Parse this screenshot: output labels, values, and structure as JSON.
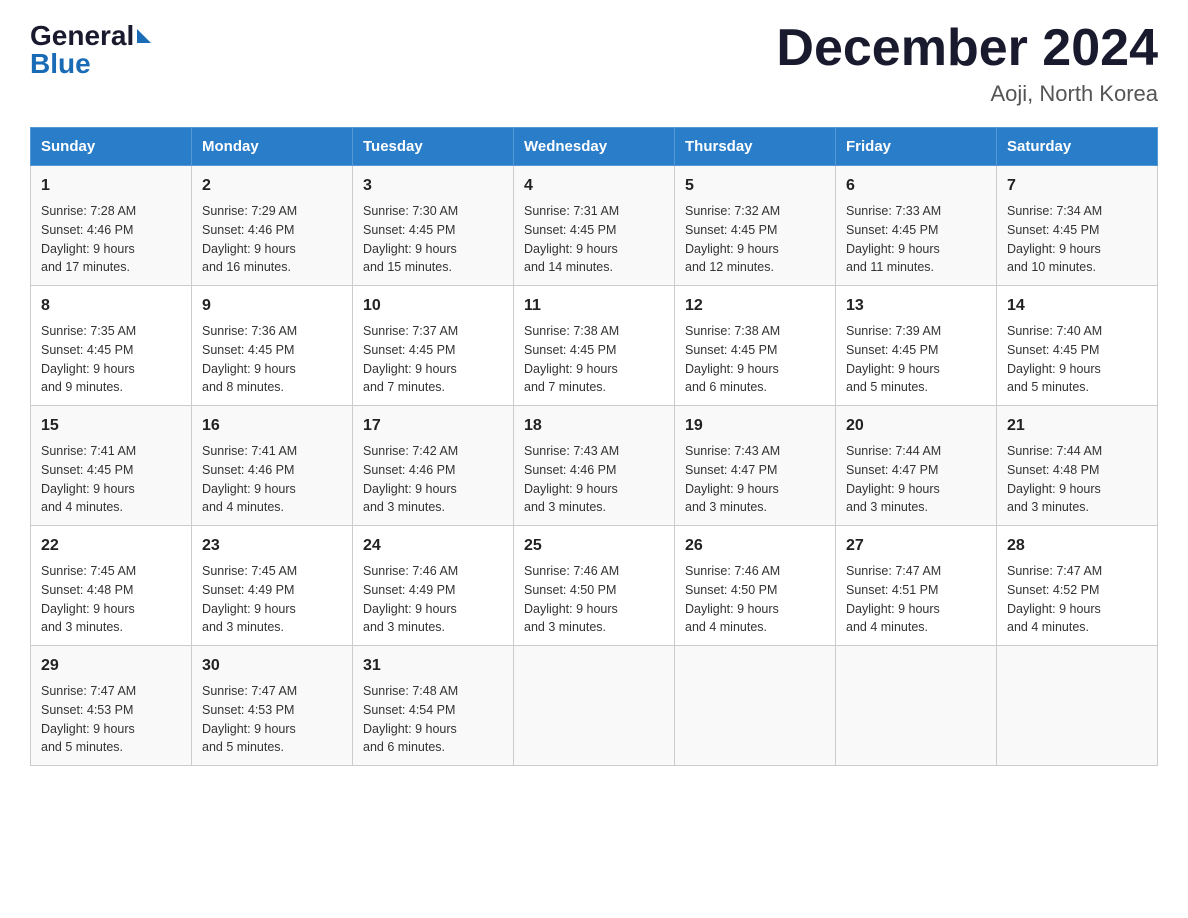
{
  "header": {
    "logo": {
      "general": "General",
      "blue": "Blue"
    },
    "title": "December 2024",
    "location": "Aoji, North Korea"
  },
  "days_of_week": [
    "Sunday",
    "Monday",
    "Tuesday",
    "Wednesday",
    "Thursday",
    "Friday",
    "Saturday"
  ],
  "weeks": [
    [
      {
        "day": "1",
        "sunrise": "7:28 AM",
        "sunset": "4:46 PM",
        "daylight": "9 hours and 17 minutes."
      },
      {
        "day": "2",
        "sunrise": "7:29 AM",
        "sunset": "4:46 PM",
        "daylight": "9 hours and 16 minutes."
      },
      {
        "day": "3",
        "sunrise": "7:30 AM",
        "sunset": "4:45 PM",
        "daylight": "9 hours and 15 minutes."
      },
      {
        "day": "4",
        "sunrise": "7:31 AM",
        "sunset": "4:45 PM",
        "daylight": "9 hours and 14 minutes."
      },
      {
        "day": "5",
        "sunrise": "7:32 AM",
        "sunset": "4:45 PM",
        "daylight": "9 hours and 12 minutes."
      },
      {
        "day": "6",
        "sunrise": "7:33 AM",
        "sunset": "4:45 PM",
        "daylight": "9 hours and 11 minutes."
      },
      {
        "day": "7",
        "sunrise": "7:34 AM",
        "sunset": "4:45 PM",
        "daylight": "9 hours and 10 minutes."
      }
    ],
    [
      {
        "day": "8",
        "sunrise": "7:35 AM",
        "sunset": "4:45 PM",
        "daylight": "9 hours and 9 minutes."
      },
      {
        "day": "9",
        "sunrise": "7:36 AM",
        "sunset": "4:45 PM",
        "daylight": "9 hours and 8 minutes."
      },
      {
        "day": "10",
        "sunrise": "7:37 AM",
        "sunset": "4:45 PM",
        "daylight": "9 hours and 7 minutes."
      },
      {
        "day": "11",
        "sunrise": "7:38 AM",
        "sunset": "4:45 PM",
        "daylight": "9 hours and 7 minutes."
      },
      {
        "day": "12",
        "sunrise": "7:38 AM",
        "sunset": "4:45 PM",
        "daylight": "9 hours and 6 minutes."
      },
      {
        "day": "13",
        "sunrise": "7:39 AM",
        "sunset": "4:45 PM",
        "daylight": "9 hours and 5 minutes."
      },
      {
        "day": "14",
        "sunrise": "7:40 AM",
        "sunset": "4:45 PM",
        "daylight": "9 hours and 5 minutes."
      }
    ],
    [
      {
        "day": "15",
        "sunrise": "7:41 AM",
        "sunset": "4:45 PM",
        "daylight": "9 hours and 4 minutes."
      },
      {
        "day": "16",
        "sunrise": "7:41 AM",
        "sunset": "4:46 PM",
        "daylight": "9 hours and 4 minutes."
      },
      {
        "day": "17",
        "sunrise": "7:42 AM",
        "sunset": "4:46 PM",
        "daylight": "9 hours and 3 minutes."
      },
      {
        "day": "18",
        "sunrise": "7:43 AM",
        "sunset": "4:46 PM",
        "daylight": "9 hours and 3 minutes."
      },
      {
        "day": "19",
        "sunrise": "7:43 AM",
        "sunset": "4:47 PM",
        "daylight": "9 hours and 3 minutes."
      },
      {
        "day": "20",
        "sunrise": "7:44 AM",
        "sunset": "4:47 PM",
        "daylight": "9 hours and 3 minutes."
      },
      {
        "day": "21",
        "sunrise": "7:44 AM",
        "sunset": "4:48 PM",
        "daylight": "9 hours and 3 minutes."
      }
    ],
    [
      {
        "day": "22",
        "sunrise": "7:45 AM",
        "sunset": "4:48 PM",
        "daylight": "9 hours and 3 minutes."
      },
      {
        "day": "23",
        "sunrise": "7:45 AM",
        "sunset": "4:49 PM",
        "daylight": "9 hours and 3 minutes."
      },
      {
        "day": "24",
        "sunrise": "7:46 AM",
        "sunset": "4:49 PM",
        "daylight": "9 hours and 3 minutes."
      },
      {
        "day": "25",
        "sunrise": "7:46 AM",
        "sunset": "4:50 PM",
        "daylight": "9 hours and 3 minutes."
      },
      {
        "day": "26",
        "sunrise": "7:46 AM",
        "sunset": "4:50 PM",
        "daylight": "9 hours and 4 minutes."
      },
      {
        "day": "27",
        "sunrise": "7:47 AM",
        "sunset": "4:51 PM",
        "daylight": "9 hours and 4 minutes."
      },
      {
        "day": "28",
        "sunrise": "7:47 AM",
        "sunset": "4:52 PM",
        "daylight": "9 hours and 4 minutes."
      }
    ],
    [
      {
        "day": "29",
        "sunrise": "7:47 AM",
        "sunset": "4:53 PM",
        "daylight": "9 hours and 5 minutes."
      },
      {
        "day": "30",
        "sunrise": "7:47 AM",
        "sunset": "4:53 PM",
        "daylight": "9 hours and 5 minutes."
      },
      {
        "day": "31",
        "sunrise": "7:48 AM",
        "sunset": "4:54 PM",
        "daylight": "9 hours and 6 minutes."
      },
      null,
      null,
      null,
      null
    ]
  ],
  "labels": {
    "sunrise": "Sunrise:",
    "sunset": "Sunset:",
    "daylight": "Daylight:"
  }
}
